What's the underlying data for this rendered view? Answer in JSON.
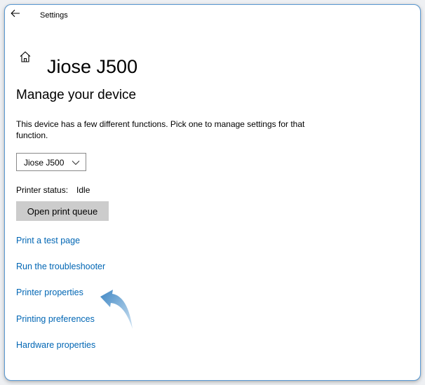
{
  "window": {
    "title": "Settings"
  },
  "header": {
    "title": "Jiose J500",
    "icon": "home-icon"
  },
  "main": {
    "section_heading": "Manage your device",
    "description": "This device has a few different functions. Pick one to manage settings for that function.",
    "device_select": {
      "value": "Jiose J500",
      "icon": "chevron-down-icon"
    },
    "printer_status": {
      "label": "Printer status:",
      "value": "Idle"
    },
    "open_queue_button": "Open print queue",
    "links": [
      "Print a test page",
      "Run the troubleshooter",
      "Printer properties",
      "Printing preferences",
      "Hardware properties"
    ]
  },
  "colors": {
    "link": "#0066b4",
    "button_bg": "#cccccc",
    "window_border": "#5b9bd5",
    "annotation_arrow": "#4a90c8"
  },
  "annotation": {
    "icon": "curved-arrow-icon"
  }
}
